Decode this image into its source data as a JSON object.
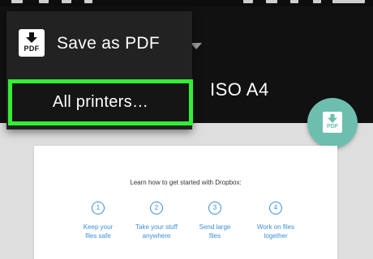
{
  "menu": {
    "pdf_option": {
      "label": "Save as PDF",
      "icon": "save-as-pdf-icon",
      "icon_text": "PDF"
    },
    "all_printers": {
      "label": "All printers…",
      "highlight_color": "#33ee33"
    }
  },
  "header": {
    "paper_size": "ISO A4"
  },
  "fab": {
    "icon": "download-pdf-icon",
    "icon_text": "PDF",
    "color": "#6dbeae"
  },
  "document": {
    "heading": "Learn how to get started with Dropbox:",
    "steps": [
      {
        "number": "1",
        "line1": "Keep your",
        "line2": "files safe"
      },
      {
        "number": "2",
        "line1": "Take your stuff",
        "line2": "anywhere"
      },
      {
        "number": "3",
        "line1": "Send large",
        "line2": "files"
      },
      {
        "number": "4",
        "line1": "Work on files",
        "line2": "together"
      }
    ]
  }
}
